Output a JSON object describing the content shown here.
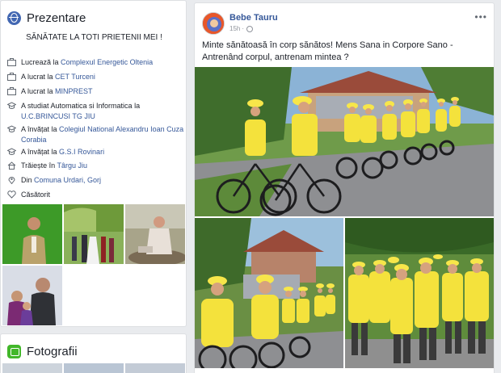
{
  "intro": {
    "title": "Prezentare",
    "bio": "SĂNĂTATE LA TOTI PRIETENII MEI !",
    "items": [
      {
        "icon": "briefcase-icon",
        "prefix": "Lucrează la",
        "link": "Complexul Energetic Oltenia"
      },
      {
        "icon": "briefcase-icon",
        "prefix": "A lucrat la",
        "link": "CET Turceni"
      },
      {
        "icon": "briefcase-icon",
        "prefix": "A lucrat la",
        "link": "MINPREST"
      },
      {
        "icon": "graduation-cap-icon",
        "prefix": "A studiat Automatica si Informatica la",
        "link": "U.C.BRINCUSI TG JIU"
      },
      {
        "icon": "graduation-cap-icon",
        "prefix": "A învățat la",
        "link": "Colegiul National Alexandru Ioan Cuza Corabia"
      },
      {
        "icon": "graduation-cap-icon",
        "prefix": "A învățat la",
        "link": "G.S.I Rovinari"
      },
      {
        "icon": "house-icon",
        "prefix": "Trăiește în",
        "link": "Târgu Jiu"
      },
      {
        "icon": "location-pin-icon",
        "prefix": "Din",
        "link": "Comuna Urdari, Gorj"
      },
      {
        "icon": "heart-icon",
        "prefix": "Căsătorit",
        "link": ""
      }
    ]
  },
  "photos": {
    "title": "Fotografii"
  },
  "post": {
    "author": "Bebe Tauru",
    "time": "15h",
    "text": "Minte sănătoasă în corp sănătos! Mens Sana in Corpore Sano - Antrenând corpul, antrenam mintea ?",
    "more": "•••"
  },
  "colors": {
    "link": "#365899",
    "background": "#e9ebee",
    "shirt_yellow": "#f4e23c"
  }
}
